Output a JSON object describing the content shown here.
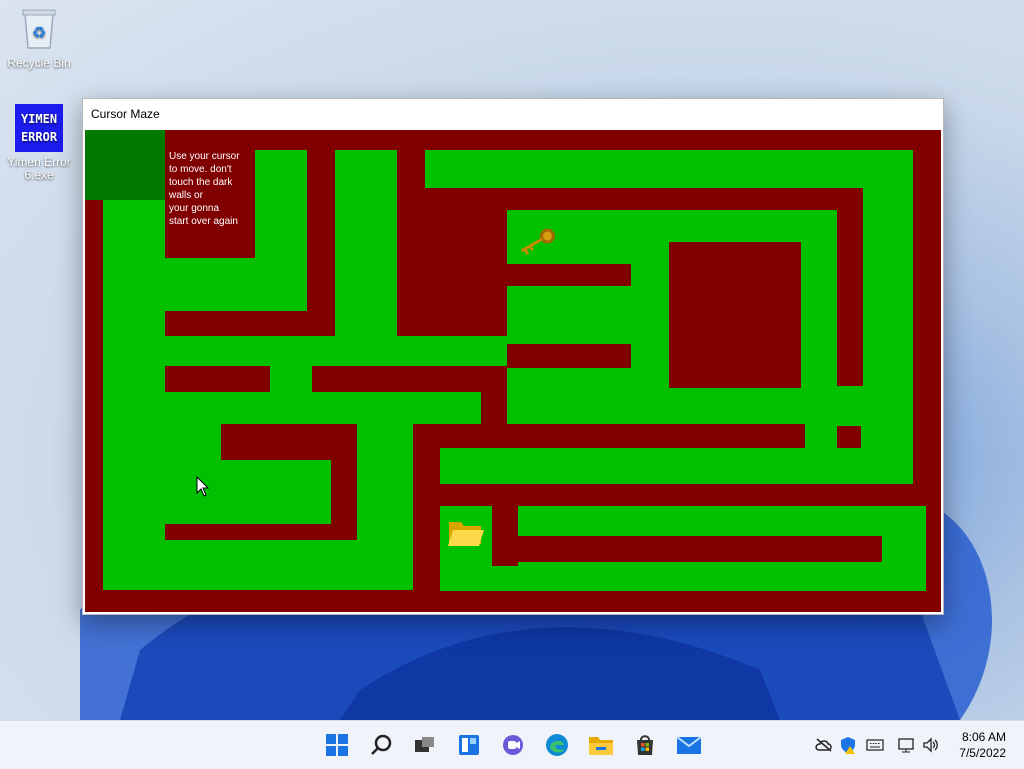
{
  "desktop": {
    "icons": [
      {
        "label": "Recycle Bin"
      },
      {
        "label": "Yimen Error 6.exe",
        "badge_line1": "YIMEN",
        "badge_line2": "ERROR"
      }
    ]
  },
  "window": {
    "title": "Cursor Maze",
    "instructions": "Use your cursor\nto move. don't\ntouch the dark\nwalls or\nyour gonna\nstart over again"
  },
  "maze_colors": {
    "wall": "#800000",
    "path": "#00c000",
    "start": "#007a00"
  },
  "taskbar": {
    "apps": [
      "start-icon",
      "search-icon",
      "task-view-icon",
      "widgets-icon",
      "teams-chat-icon",
      "edge-icon",
      "file-explorer-icon",
      "store-icon",
      "mail-icon"
    ],
    "clock": {
      "time": "8:06 AM",
      "date": "7/5/2022"
    }
  }
}
